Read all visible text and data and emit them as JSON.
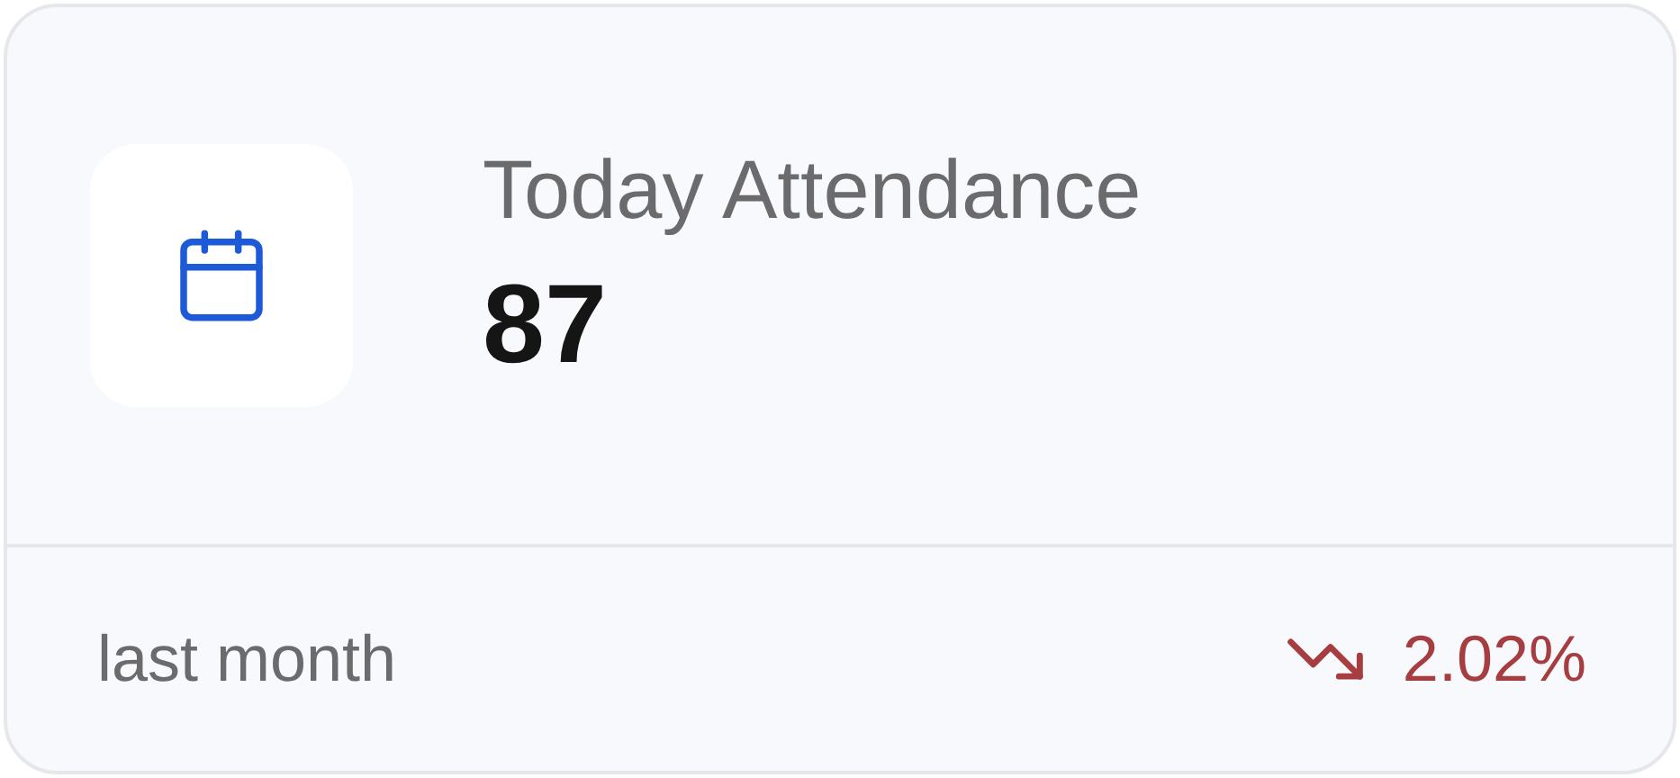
{
  "stat_card": {
    "title": "Today Attendance",
    "value": "87",
    "footer": {
      "label": "last month",
      "trend": {
        "kind": "down",
        "value": "2.02%"
      }
    }
  }
}
